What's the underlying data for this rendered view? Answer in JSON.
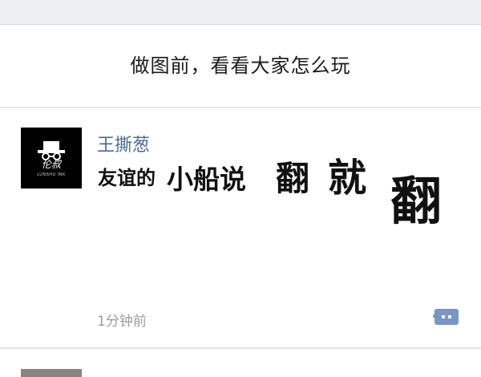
{
  "prompt": {
    "text": "做图前，看看大家怎么玩"
  },
  "post": {
    "avatar_icon": "hat-glasses-logo",
    "avatar_text": "伦叔",
    "avatar_sub": "LUNSHU INK",
    "username": "王撕葱",
    "text_parts": [
      "友谊的",
      "小船说",
      "翻",
      "就",
      "翻"
    ],
    "timestamp": "1分钟前",
    "comment_icon": "comment-dots-icon"
  },
  "colors": {
    "username": "#4a6a9a",
    "comment_icon": "#7a96c6",
    "timestamp": "#9b9b9b",
    "top_strip": "#eeeff2"
  }
}
